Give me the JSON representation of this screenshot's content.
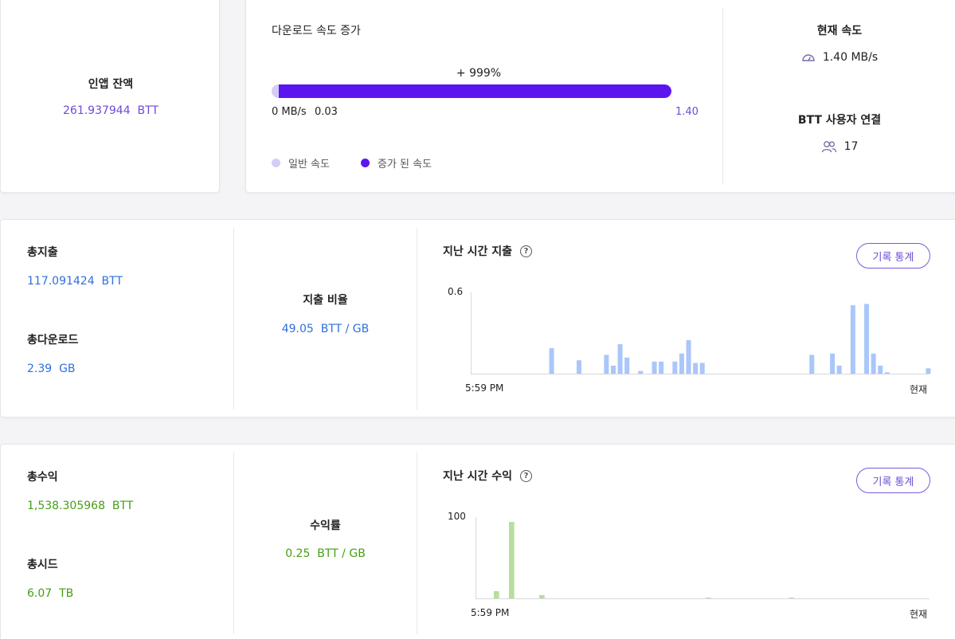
{
  "balance": {
    "label": "인앱 잔액",
    "amount": "261.937944",
    "unit": "BTT"
  },
  "speed": {
    "title": "다운로드 속도 증가",
    "increase": "+ 999%",
    "base_label": "0 MB/s",
    "normal_value": "0.03",
    "boosted_value": "1.40",
    "boost_fraction": 1.0,
    "legend_normal": "일반 속도",
    "legend_boosted": "증가 된 속도"
  },
  "current": {
    "speed_label": "현재 속도",
    "speed_value": "1.40 MB/s",
    "connections_label": "BTT 사용자 연결",
    "connections_value": "17",
    "speed_icon": "speedometer-icon",
    "users_icon": "users-icon"
  },
  "spend": {
    "total_label": "총지출",
    "total_value": "117.091424",
    "total_unit": "BTT",
    "download_label": "총다운로드",
    "download_value": "2.39",
    "download_unit": "GB",
    "rate_label": "지출 비율",
    "rate_value": "49.05",
    "rate_unit": "BTT / GB",
    "chart_title": "지난 시간 지출",
    "history_button": "기록 통계",
    "ymax_label": "0.6",
    "x_start": "5:59 PM",
    "x_end": "현재"
  },
  "earn": {
    "total_label": "총수익",
    "total_value": "1,538.305968",
    "total_unit": "BTT",
    "seed_label": "총시드",
    "seed_value": "6.07",
    "seed_unit": "TB",
    "rate_label": "수익률",
    "rate_value": "0.25",
    "rate_unit": "BTT / GB",
    "chart_title": "지난 시간 수익",
    "history_button": "기록 통계",
    "ymax_label": "100",
    "x_start": "5:59 PM",
    "x_end": "현재"
  },
  "colors": {
    "purple": "#6f4bd8",
    "boost": "#5b16f0",
    "blue": "#2f6fe0",
    "green": "#44a014",
    "spend_bar": "#aac6fa",
    "earn_bar": "#b9dd9b"
  },
  "chart_data": [
    {
      "type": "bar",
      "title": "지난 시간 지출",
      "ylim": [
        0,
        0.6
      ],
      "x_range": [
        "5:59 PM",
        "현재"
      ],
      "slots": 60,
      "values": [
        0,
        0,
        0,
        0,
        0,
        0,
        0,
        0,
        0,
        0,
        0,
        0.19,
        0,
        0,
        0,
        0.1,
        0,
        0,
        0,
        0.14,
        0.06,
        0.22,
        0.12,
        0,
        0.02,
        0,
        0.09,
        0.09,
        0,
        0.09,
        0.15,
        0.25,
        0.08,
        0.08,
        0,
        0,
        0,
        0,
        0,
        0,
        0,
        0,
        0,
        0,
        0,
        0,
        0,
        0,
        0,
        0.14,
        0,
        0,
        0.15,
        0.06,
        0,
        0.51,
        0,
        0.52,
        0.15,
        0.06,
        0.01,
        0,
        0,
        0,
        0,
        0,
        0.04
      ]
    },
    {
      "type": "bar",
      "title": "지난 시간 수익",
      "ylim": [
        0,
        100
      ],
      "x_range": [
        "5:59 PM",
        "현재"
      ],
      "slots": 60,
      "values": [
        0,
        0,
        9,
        0,
        95,
        0,
        0,
        0,
        4,
        0,
        0,
        0,
        0,
        0,
        0,
        0,
        0,
        0,
        0,
        0,
        0,
        0,
        0,
        0,
        0,
        0,
        0,
        0,
        0,
        0,
        0.5,
        0,
        0,
        0,
        0,
        0,
        0,
        0,
        0,
        0,
        0,
        0.5,
        0,
        0,
        0,
        0,
        0,
        0,
        0,
        0,
        0,
        0,
        0,
        0,
        0,
        0,
        0,
        0,
        0,
        0
      ]
    }
  ]
}
